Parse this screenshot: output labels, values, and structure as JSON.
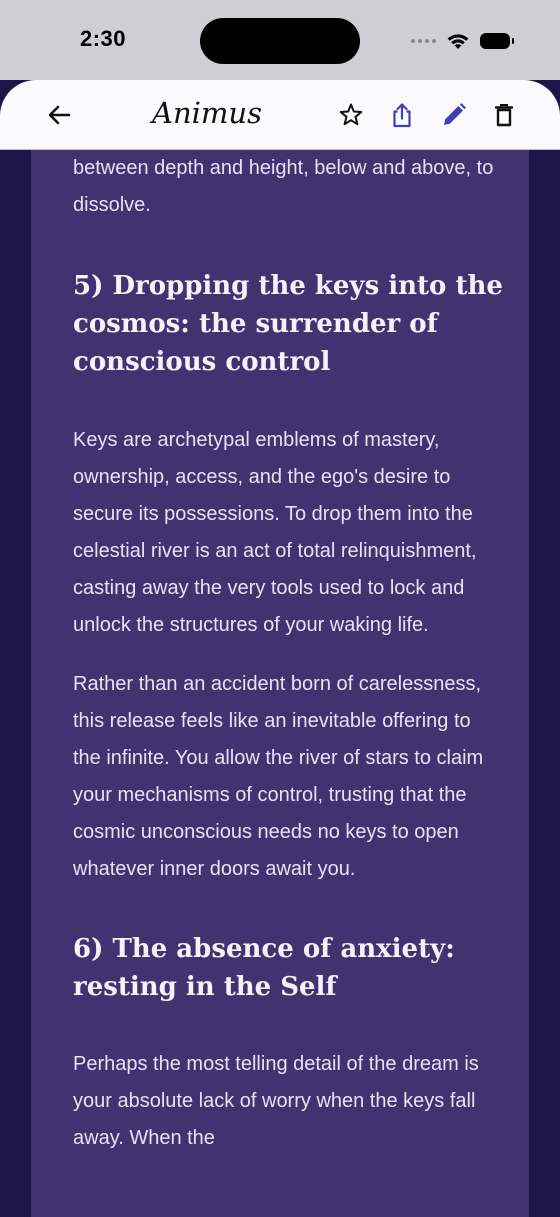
{
  "status_bar": {
    "time": "2:30"
  },
  "app_bar": {
    "title": "Animus",
    "icons": [
      "back-arrow-icon",
      "star-icon",
      "share-icon",
      "pencil-icon",
      "trash-icon"
    ],
    "accent_color": "#3f3fb8"
  },
  "article": {
    "intro_tail": "between depth and height, below and above, to dissolve.",
    "section5": {
      "heading": "5) Dropping the keys into the cosmos: the surrender of conscious control",
      "p1": "Keys are archetypal emblems of mastery, ownership, access, and the ego's desire to secure its possessions. To drop them into the celestial river is an act of total relinquishment, casting away the very tools used to lock and unlock the structures of your waking life.",
      "p2": "Rather than an accident born of carelessness, this release feels like an inevitable offering to the infinite. You allow the river of stars to claim your mechanisms of control, trusting that the cosmic unconscious needs no keys to open whatever inner doors await you."
    },
    "section6": {
      "heading": "6) The absence of anxiety: resting in the Self",
      "p1": "Perhaps the most telling detail of the dream is your absolute lack of worry when the keys fall away. When the"
    }
  },
  "colors": {
    "background": "#1e1548",
    "content_panel": "#41336f",
    "text": "#e6e2f5"
  }
}
